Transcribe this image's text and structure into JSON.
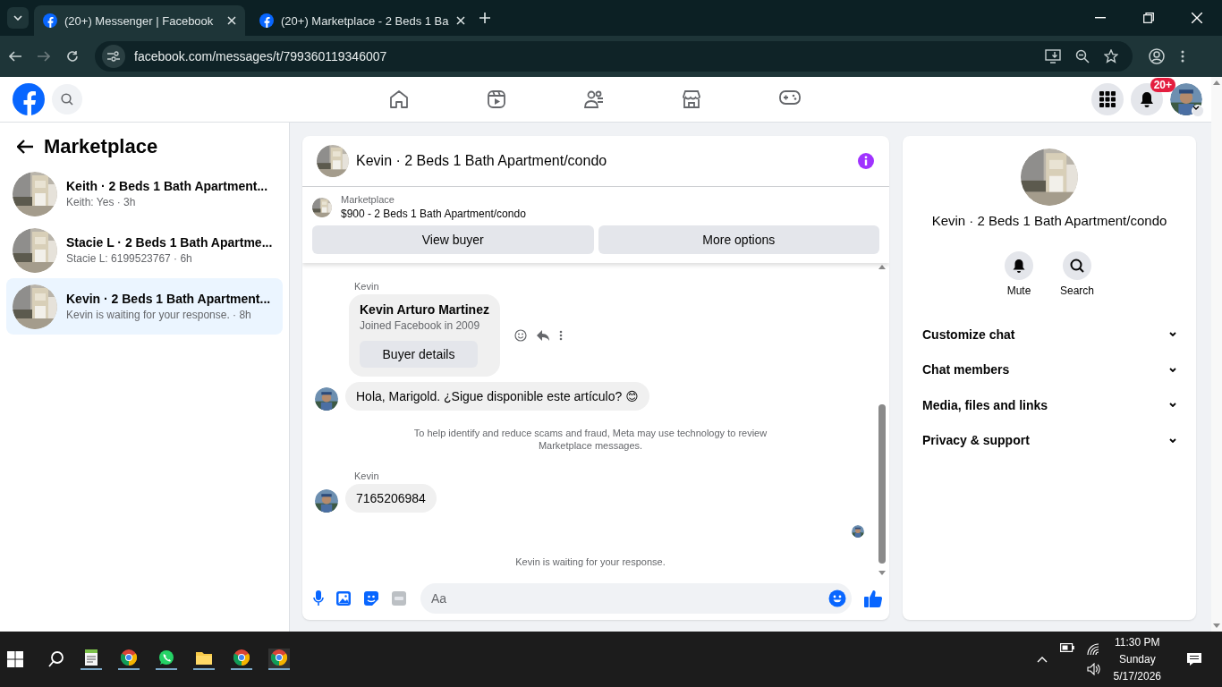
{
  "browser": {
    "tabs": [
      {
        "title": "(20+) Messenger | Facebook",
        "selected": true
      },
      {
        "title": "(20+) Marketplace - 2 Beds 1 Ba",
        "selected": false
      }
    ],
    "url": "facebook.com/messages/t/799360119346007"
  },
  "header": {
    "notification_badge": "20+"
  },
  "sidebar": {
    "title": "Marketplace",
    "conversations": [
      {
        "title": "Keith · 2 Beds 1 Bath Apartment...",
        "preview": "Keith: Yes · 3h",
        "selected": false
      },
      {
        "title": "Stacie L · 2 Beds 1 Bath Apartme...",
        "preview": "Stacie L: 6199523767 · 6h",
        "selected": false
      },
      {
        "title": "Kevin · 2 Beds 1 Bath Apartment...",
        "preview": "Kevin is waiting for your response. · 8h",
        "selected": true
      }
    ]
  },
  "chat": {
    "title": "Kevin · 2 Beds 1 Bath Apartment/condo",
    "listing": {
      "label": "Marketplace",
      "title": "$900 - 2 Beds 1 Bath Apartment/condo"
    },
    "buttons": [
      "View buyer",
      "More options"
    ],
    "messages": [
      {
        "kind": "card",
        "sender": "Kevin",
        "name": "Kevin Arturo Martinez",
        "subtitle": "Joined Facebook in 2009",
        "button": "Buyer details"
      },
      {
        "kind": "text",
        "text": "Hola, Marigold. ¿Sigue disponible este artículo? 😊"
      },
      {
        "kind": "notice",
        "text": "To help identify and reduce scams and fraud, Meta may use technology to review Marketplace messages."
      },
      {
        "kind": "text",
        "sender": "Kevin",
        "text": "7165206984"
      },
      {
        "kind": "seen"
      },
      {
        "kind": "notice",
        "text": "Kevin is waiting for your response."
      }
    ],
    "composer": {
      "placeholder": "Aa"
    }
  },
  "details": {
    "title": "Kevin · 2 Beds 1 Bath Apartment/condo",
    "actions": [
      {
        "kind": "mute",
        "label": "Mute"
      },
      {
        "kind": "search",
        "label": "Search"
      }
    ],
    "sections": [
      "Customize chat",
      "Chat members",
      "Media, files and links",
      "Privacy & support"
    ]
  },
  "taskbar": {
    "time": "11:30 PM",
    "day": "Sunday",
    "date": "5/17/2026"
  }
}
